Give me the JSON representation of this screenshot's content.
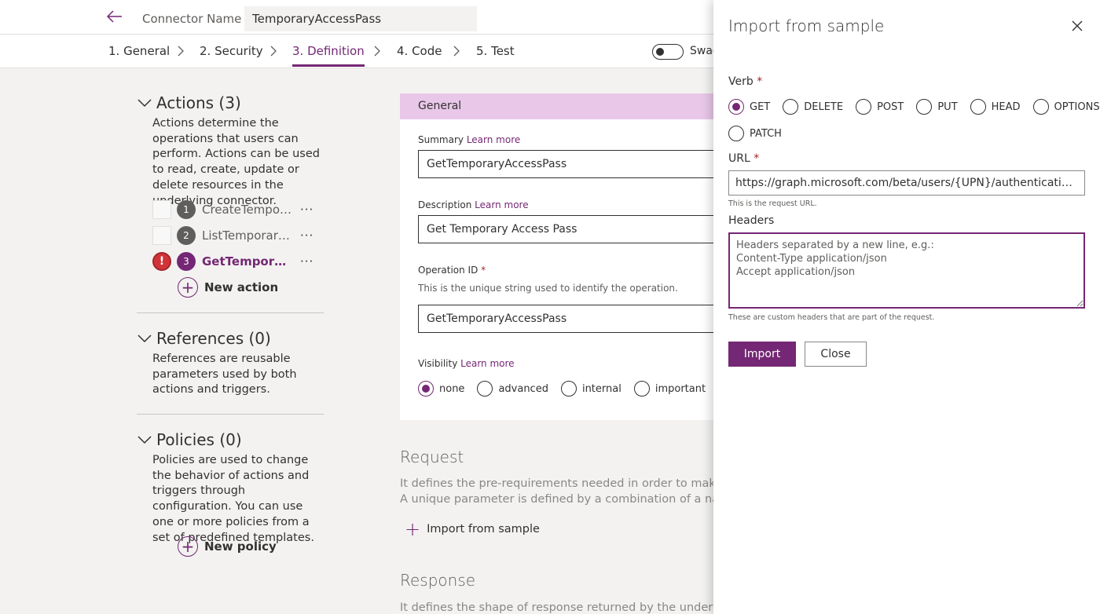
{
  "header": {
    "back_icon": "back-arrow-icon",
    "connector_name_label": "Connector Name",
    "connector_name_value": "TemporaryAccessPass"
  },
  "steps": [
    {
      "label": "1. General"
    },
    {
      "label": "2. Security"
    },
    {
      "label": "3. Definition"
    },
    {
      "label": "4. Code"
    },
    {
      "label": "5. Test"
    }
  ],
  "swagger": {
    "label": "Swag"
  },
  "accent_color": "#742774",
  "left": {
    "actions": {
      "title": "Actions (3)",
      "description": "Actions determine the operations that users can perform. Actions can be used to read, create, update or delete resources in the underlying connector.",
      "items": [
        {
          "num": "1",
          "name": "CreateTemporaryAccessPass"
        },
        {
          "num": "2",
          "name": "ListTemporaryAccessPass"
        },
        {
          "num": "3",
          "name": "GetTemporaryAccessPass"
        }
      ],
      "more": "···",
      "new_label": "New action"
    },
    "references": {
      "title": "References (0)",
      "description": "References are reusable parameters used by both actions and triggers."
    },
    "policies": {
      "title": "Policies (0)",
      "description": "Policies are used to change the behavior of actions and triggers through configuration. You can use one or more policies from a set of predefined templates.",
      "new_label": "New policy"
    }
  },
  "general": {
    "title": "General",
    "learn_more": "Learn more",
    "summary_label": "Summary",
    "summary_value": "GetTemporaryAccessPass",
    "description_label": "Description",
    "description_value": "Get Temporary Access Pass",
    "operation_id_label": "Operation ID",
    "required_mark": "*",
    "operation_id_hint": "This is the unique string used to identify the operation.",
    "operation_id_value": "GetTemporaryAccessPass",
    "visibility_label": "Visibility",
    "visibility_options": [
      "none",
      "advanced",
      "internal",
      "important"
    ],
    "visibility_selected": "none"
  },
  "request": {
    "title": "Request",
    "desc_line1": "It defines the pre-requirements needed in order to make a reque",
    "desc_line2": "A unique parameter is defined by a combination of a name and l",
    "import_label": "Import from sample"
  },
  "response": {
    "title": "Response",
    "desc_line1": "It defines the shape of response returned by the underlying conn"
  },
  "panel": {
    "title": "Import from sample",
    "verb_label": "Verb",
    "verbs": [
      "GET",
      "DELETE",
      "POST",
      "PUT",
      "HEAD",
      "OPTIONS",
      "PATCH"
    ],
    "verb_selected": "GET",
    "url_label": "URL",
    "url_value": "https://graph.microsoft.com/beta/users/{UPN}/authentication/temporaryAccessPassMethods",
    "url_hint": "This is the request URL.",
    "headers_label": "Headers",
    "headers_placeholder": "Headers separated by a new line, e.g.:\nContent-Type application/json\nAccept application/json",
    "headers_hint": "These are custom headers that are part of the request.",
    "import_button": "Import",
    "close_button": "Close"
  }
}
